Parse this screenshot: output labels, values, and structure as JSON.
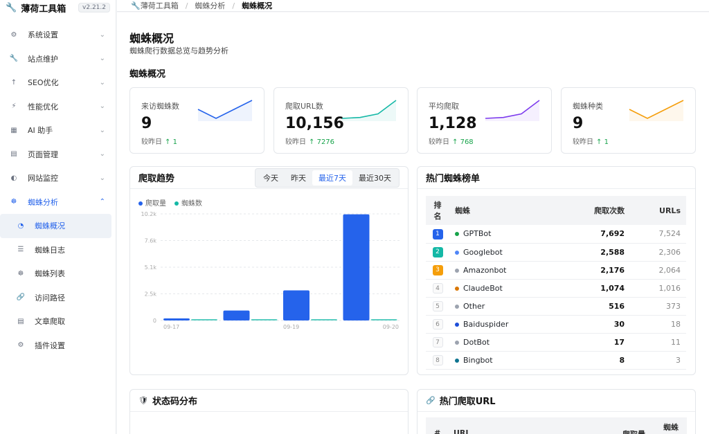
{
  "app": {
    "name": "薄荷工具箱",
    "version": "v2.21.2"
  },
  "colors": {
    "accent": "#2563eb",
    "up": "#16a34a"
  },
  "sidebar": {
    "items": [
      {
        "label": "系统设置",
        "icon": "gear-icon"
      },
      {
        "label": "站点维护",
        "icon": "wrench-icon"
      },
      {
        "label": "SEO优化",
        "icon": "arrow-up-icon"
      },
      {
        "label": "性能优化",
        "icon": "lightning-icon"
      },
      {
        "label": "AI 助手",
        "icon": "robot-icon"
      },
      {
        "label": "页面管理",
        "icon": "file-icon"
      },
      {
        "label": "网站监控",
        "icon": "monitor-icon"
      },
      {
        "label": "蜘蛛分析",
        "icon": "bug-icon"
      }
    ],
    "sub_items": [
      {
        "label": "蜘蛛概况",
        "icon": "dashboard-icon"
      },
      {
        "label": "蜘蛛日志",
        "icon": "list-icon"
      },
      {
        "label": "蜘蛛列表",
        "icon": "bug-icon"
      },
      {
        "label": "访问路径",
        "icon": "link-icon"
      },
      {
        "label": "文章爬取",
        "icon": "document-icon"
      },
      {
        "label": "插件设置",
        "icon": "gear-icon"
      }
    ]
  },
  "breadcrumb": [
    "薄荷工具箱",
    "蜘蛛分析",
    "蜘蛛概况"
  ],
  "page": {
    "title": "蜘蛛概况",
    "subtitle": "蜘蛛爬行数据总览与趋势分析",
    "section": "蜘蛛概况"
  },
  "stats": [
    {
      "label": "来访蜘蛛数",
      "value": "9",
      "delta_label": "较昨日",
      "delta": "1",
      "color": "#2563eb",
      "spark": [
        5,
        4,
        5,
        6
      ]
    },
    {
      "label": "爬取URL数",
      "value": "10,156",
      "delta_label": "较昨日",
      "delta": "7276",
      "color": "#14b8a6",
      "spark": [
        2,
        2.3,
        3.5,
        8
      ]
    },
    {
      "label": "平均爬取",
      "value": "1,128",
      "delta_label": "较昨日",
      "delta": "768",
      "color": "#7c3aed",
      "spark": [
        2,
        2.3,
        3.5,
        8
      ]
    },
    {
      "label": "蜘蛛种类",
      "value": "9",
      "delta_label": "较昨日",
      "delta": "1",
      "color": "#f59e0b",
      "spark": [
        5,
        4.5,
        5,
        5.5
      ]
    }
  ],
  "trend": {
    "title": "爬取趋势",
    "tabs": [
      "今天",
      "昨天",
      "最近7天",
      "最近30天"
    ],
    "active_tab": "最近7天",
    "legend": [
      {
        "name": "爬取量",
        "color": "#2563eb"
      },
      {
        "name": "蜘蛛数",
        "color": "#14b8a6"
      }
    ]
  },
  "chart_data": {
    "type": "bar",
    "categories": [
      "09-17",
      "09-18",
      "09-19",
      "09-20"
    ],
    "x_tick_labels": [
      "09-17",
      "09-19",
      "09-20"
    ],
    "series": [
      {
        "name": "爬取量",
        "values": [
          200,
          950,
          2880,
          10156
        ]
      },
      {
        "name": "蜘蛛数",
        "values": [
          9,
          9,
          9,
          9
        ]
      }
    ],
    "y_ticks": [
      "0",
      "2.5k",
      "5.1k",
      "7.6k",
      "10.2k"
    ],
    "ylim": [
      0,
      10200
    ],
    "grid": true,
    "legend": "top-left"
  },
  "rank": {
    "title": "热门蜘蛛榜单",
    "headers": [
      "排名",
      "蜘蛛",
      "爬取次数",
      "URLs"
    ],
    "rows": [
      {
        "rank": "1",
        "name": "GPTBot",
        "count": "7,692",
        "urls": "7,524",
        "badge": "#2563eb",
        "dot": "#16a34a"
      },
      {
        "rank": "2",
        "name": "Googlebot",
        "count": "2,588",
        "urls": "2,306",
        "badge": "#14b8a6",
        "dot": "#4f86f7"
      },
      {
        "rank": "3",
        "name": "Amazonbot",
        "count": "2,176",
        "urls": "2,064",
        "badge": "#f59e0b",
        "dot": "#9ca3af"
      },
      {
        "rank": "4",
        "name": "ClaudeBot",
        "count": "1,074",
        "urls": "1,016",
        "badge": "",
        "dot": "#d97706"
      },
      {
        "rank": "5",
        "name": "Other",
        "count": "516",
        "urls": "373",
        "badge": "",
        "dot": "#9ca3af"
      },
      {
        "rank": "6",
        "name": "Baiduspider",
        "count": "30",
        "urls": "18",
        "badge": "",
        "dot": "#1d4ed8"
      },
      {
        "rank": "7",
        "name": "DotBot",
        "count": "17",
        "urls": "11",
        "badge": "",
        "dot": "#9ca3af"
      },
      {
        "rank": "8",
        "name": "Bingbot",
        "count": "8",
        "urls": "3",
        "badge": "",
        "dot": "#0e7490"
      }
    ]
  },
  "status_card": {
    "title": "状态码分布"
  },
  "url_card": {
    "title": "热门爬取URL",
    "headers": [
      "#",
      "URL",
      "爬取量",
      "蜘蛛"
    ]
  }
}
